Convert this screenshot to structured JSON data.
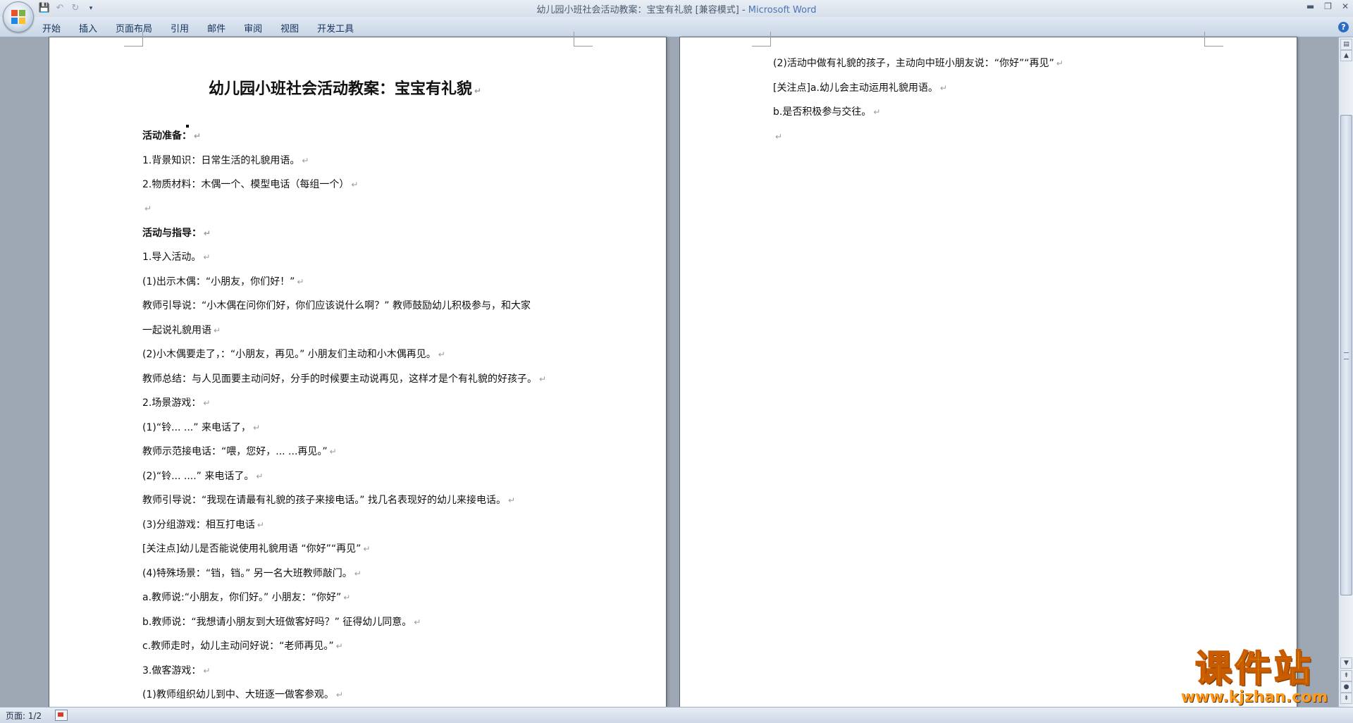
{
  "window": {
    "title": "幼儿园小班社会活动教案：宝宝有礼貌 [兼容模式]",
    "app_name": "Microsoft Word",
    "controls": [
      "▬",
      "❐",
      "✕"
    ]
  },
  "quick_access": [
    "save-icon",
    "undo-icon",
    "redo-icon",
    "customize-icon"
  ],
  "ribbon": {
    "tabs": [
      "开始",
      "插入",
      "页面布局",
      "引用",
      "邮件",
      "审阅",
      "视图",
      "开发工具"
    ]
  },
  "document": {
    "page1": {
      "title": "幼儿园小班社会活动教案：宝宝有礼貌",
      "lines": [
        "活动准备：",
        "1.背景知识：日常生活的礼貌用语。",
        "2.物质材料：木偶一个、模型电话（每组一个）",
        "",
        "活动与指导：",
        "1.导入活动。",
        " (1)出示木偶：“小朋友，你们好！”",
        "教师引导说：“小木偶在问你们好，你们应该说什么啊？” 教师鼓励幼儿积极参与，和大家",
        "一起说礼貌用语",
        " (2)小木偶要走了，：“小朋友，再见。” 小朋友们主动和小木偶再见。",
        "教师总结：与人见面要主动问好，分手的时候要主动说再见，这样才是个有礼貌的好孩子。",
        "2.场景游戏：",
        "  (1)“铃... ...” 来电话了，",
        " 教师示范接电话：“喂，您好，...  ...再见。”",
        "  (2)“铃... ....” 来电话了。",
        " 教师引导说：“我现在请最有礼貌的孩子来接电话。” 找几名表现好的幼儿来接电话。",
        "  (3)分组游戏：相互打电话",
        " [关注点]幼儿是否能说使用礼貌用语 “你好”“再见”",
        "  (4)特殊场景：“铛，铛。” 另一名大班教师敲门。",
        " a.教师说:“小朋友，你们好。” 小朋友：“你好”",
        " b.教师说：“我想请小朋友到大班做客好吗？” 征得幼儿同意。",
        "  c.教师走时，幼儿主动问好说：“老师再见。”",
        "3.做客游戏：",
        "  (1)教师组织幼儿到中、大班逐一做客参观。"
      ]
    },
    "page2": {
      "lines": [
        "  (2)活动中做有礼貌的孩子，主动向中班小朋友说：“你好”“再见”",
        "[关注点]a.幼儿会主动运用礼貌用语。",
        "            b.是否积极参与交往。",
        ""
      ]
    }
  },
  "statusbar": {
    "page_count": "页面: 1/2"
  },
  "watermark": {
    "logo_text": "课件站",
    "url": "www.kjzhan.com"
  }
}
